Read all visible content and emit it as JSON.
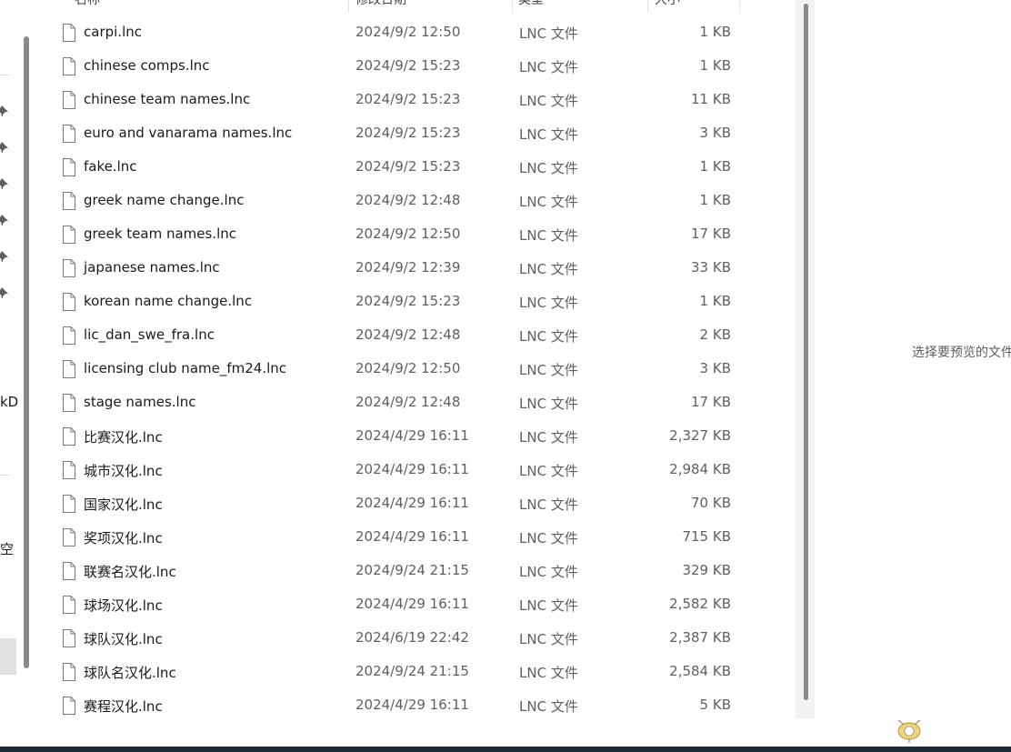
{
  "columns": {
    "name": "名称",
    "date": "修改日期",
    "type": "类型",
    "size": "大小"
  },
  "nav": {
    "fragment_kd": "kD",
    "fragment_kong": "空"
  },
  "files": [
    {
      "name": "carpi.lnc",
      "date": "2024/9/2 12:50",
      "type": "LNC 文件",
      "size": "1 KB"
    },
    {
      "name": "chinese comps.lnc",
      "date": "2024/9/2 15:23",
      "type": "LNC 文件",
      "size": "1 KB"
    },
    {
      "name": "chinese team names.lnc",
      "date": "2024/9/2 15:23",
      "type": "LNC 文件",
      "size": "11 KB"
    },
    {
      "name": "euro and vanarama names.lnc",
      "date": "2024/9/2 15:23",
      "type": "LNC 文件",
      "size": "3 KB"
    },
    {
      "name": "fake.lnc",
      "date": "2024/9/2 15:23",
      "type": "LNC 文件",
      "size": "1 KB"
    },
    {
      "name": "greek name change.lnc",
      "date": "2024/9/2 12:48",
      "type": "LNC 文件",
      "size": "1 KB"
    },
    {
      "name": "greek team names.lnc",
      "date": "2024/9/2 12:50",
      "type": "LNC 文件",
      "size": "17 KB"
    },
    {
      "name": "japanese names.lnc",
      "date": "2024/9/2 12:39",
      "type": "LNC 文件",
      "size": "33 KB"
    },
    {
      "name": "korean name change.lnc",
      "date": "2024/9/2 15:23",
      "type": "LNC 文件",
      "size": "1 KB"
    },
    {
      "name": "lic_dan_swe_fra.lnc",
      "date": "2024/9/2 12:48",
      "type": "LNC 文件",
      "size": "2 KB"
    },
    {
      "name": "licensing club name_fm24.lnc",
      "date": "2024/9/2 12:50",
      "type": "LNC 文件",
      "size": "3 KB"
    },
    {
      "name": "stage names.lnc",
      "date": "2024/9/2 12:48",
      "type": "LNC 文件",
      "size": "17 KB"
    },
    {
      "name": "比赛汉化.lnc",
      "date": "2024/4/29 16:11",
      "type": "LNC 文件",
      "size": "2,327 KB"
    },
    {
      "name": "城市汉化.lnc",
      "date": "2024/4/29 16:11",
      "type": "LNC 文件",
      "size": "2,984 KB"
    },
    {
      "name": "国家汉化.lnc",
      "date": "2024/4/29 16:11",
      "type": "LNC 文件",
      "size": "70 KB"
    },
    {
      "name": "奖项汉化.lnc",
      "date": "2024/4/29 16:11",
      "type": "LNC 文件",
      "size": "715 KB"
    },
    {
      "name": "联赛名汉化.lnc",
      "date": "2024/9/24 21:15",
      "type": "LNC 文件",
      "size": "329 KB"
    },
    {
      "name": "球场汉化.lnc",
      "date": "2024/4/29 16:11",
      "type": "LNC 文件",
      "size": "2,582 KB"
    },
    {
      "name": "球队汉化.lnc",
      "date": "2024/6/19 22:42",
      "type": "LNC 文件",
      "size": "2,387 KB"
    },
    {
      "name": "球队名汉化.lnc",
      "date": "2024/9/24 21:15",
      "type": "LNC 文件",
      "size": "2,584 KB"
    },
    {
      "name": "赛程汉化.lnc",
      "date": "2024/4/29 16:11",
      "type": "LNC 文件",
      "size": "5 KB"
    }
  ],
  "preview": {
    "message": "选择要预览的文件"
  },
  "colors": {
    "scrollbar": "#8a8a8a",
    "pane_background": "#f2f2f2",
    "taskbar": "#1f2a36"
  },
  "icons": {
    "file": "document-icon",
    "pin": "pin-icon",
    "mascot": "mascot-icon"
  }
}
